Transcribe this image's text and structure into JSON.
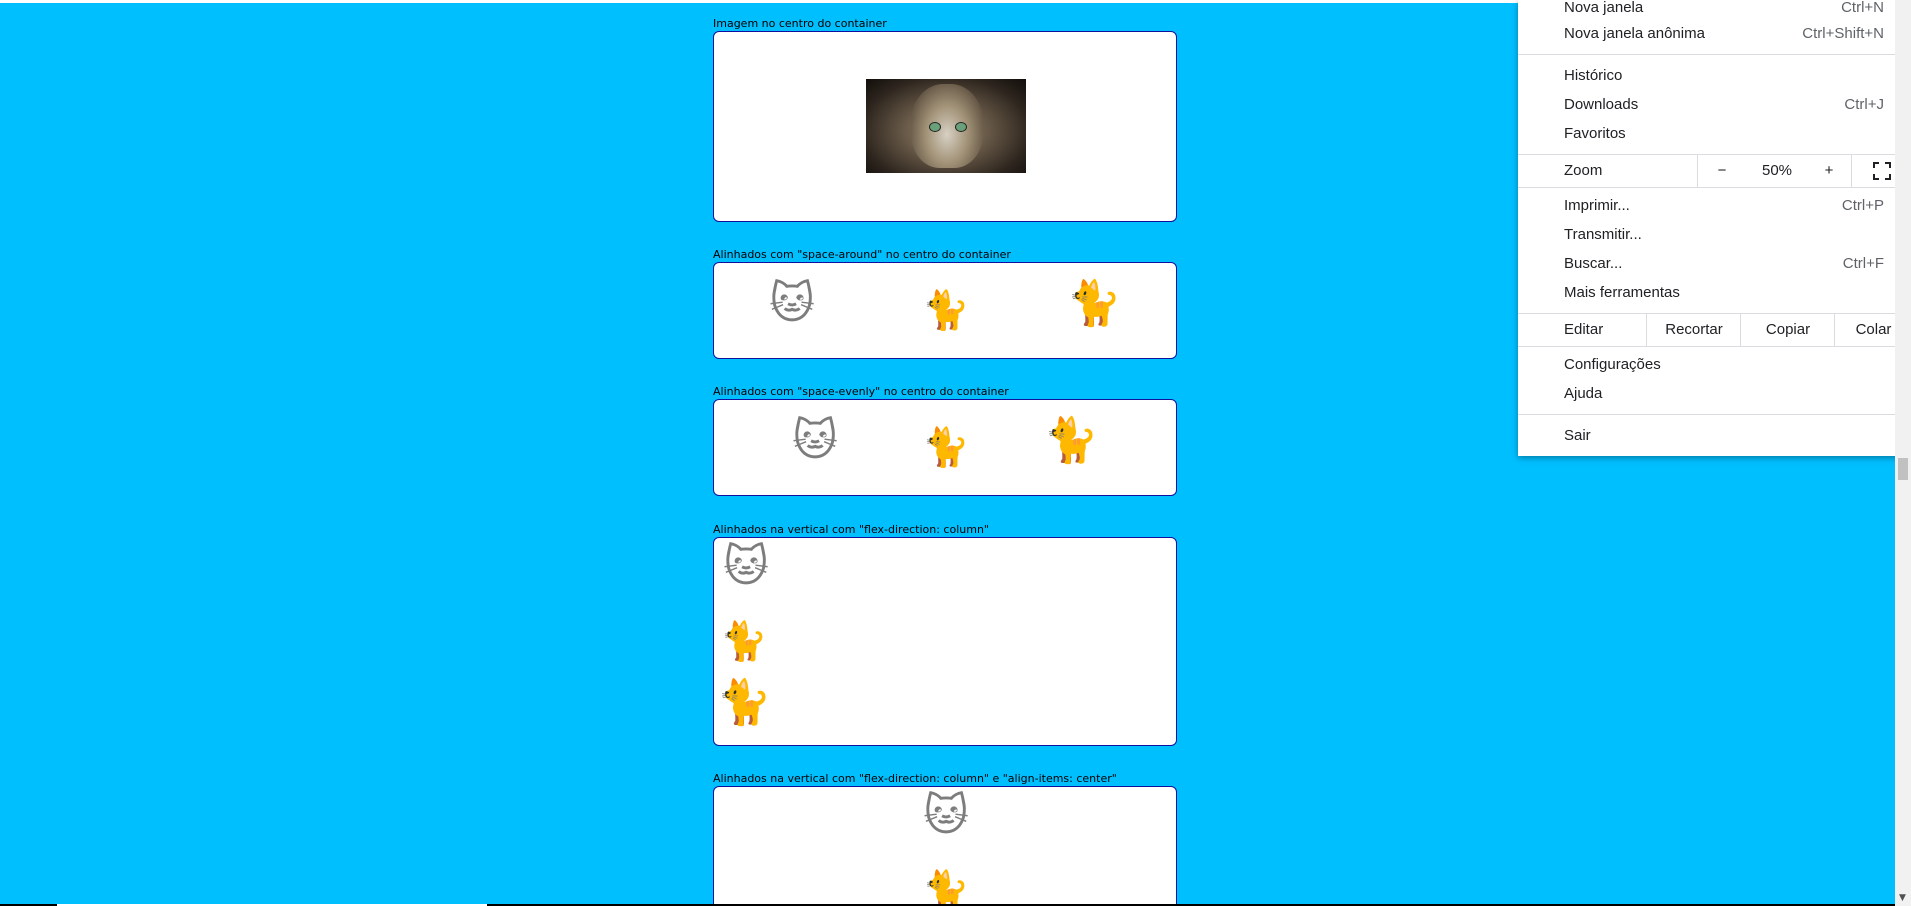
{
  "sections": [
    {
      "label": "Imagem no centro do container"
    },
    {
      "label": "Alinhados com \"space-around\" no centro do container"
    },
    {
      "label": "Alinhados com \"space-evenly\" no centro do container"
    },
    {
      "label": "Alinhados na vertical com \"flex-direction: column\""
    },
    {
      "label": "Alinhados na vertical com \"flex-direction: column\" e \"align-items: center\""
    }
  ],
  "icons": [
    "cat-photo",
    "tabby-cat-icon",
    "white-cat-icon",
    "orange-cat-icon"
  ],
  "menu": {
    "new_window": {
      "label": "Nova janela",
      "shortcut": "Ctrl+N"
    },
    "incognito": {
      "label": "Nova janela anônima",
      "shortcut": "Ctrl+Shift+N"
    },
    "history": {
      "label": "Histórico"
    },
    "downloads": {
      "label": "Downloads",
      "shortcut": "Ctrl+J"
    },
    "bookmarks": {
      "label": "Favoritos"
    },
    "zoom": {
      "label": "Zoom",
      "minus": "−",
      "value": "50%",
      "plus": "+"
    },
    "print": {
      "label": "Imprimir...",
      "shortcut": "Ctrl+P"
    },
    "cast": {
      "label": "Transmitir..."
    },
    "find": {
      "label": "Buscar...",
      "shortcut": "Ctrl+F"
    },
    "more_tools": {
      "label": "Mais ferramentas"
    },
    "edit": {
      "label": "Editar",
      "cut": "Recortar",
      "copy": "Copiar",
      "paste": "Colar"
    },
    "settings": {
      "label": "Configurações"
    },
    "help": {
      "label": "Ajuda"
    },
    "exit": {
      "label": "Sair"
    }
  },
  "colors": {
    "page_background": "#00bfff",
    "container_border": "#1010a0",
    "menu_background": "#ffffff"
  }
}
